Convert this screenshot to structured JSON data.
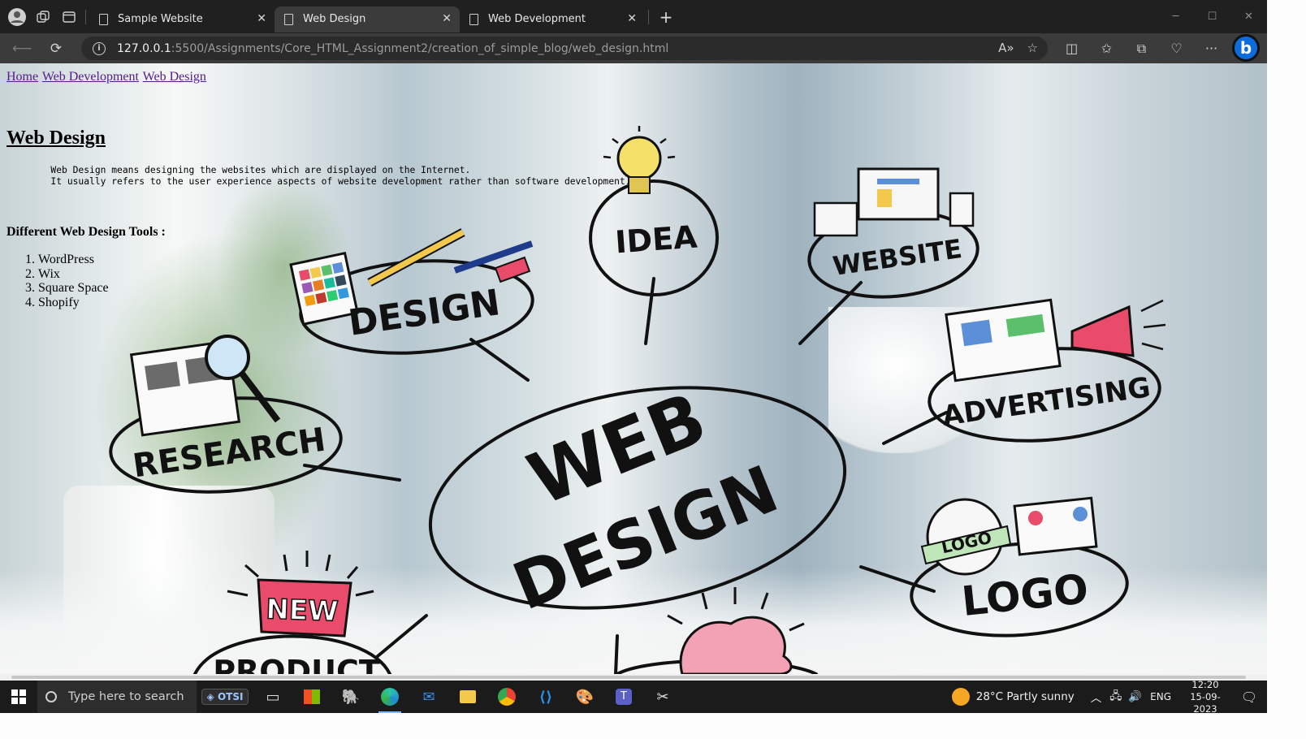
{
  "browser": {
    "tabs": [
      {
        "title": "Sample Website",
        "active": false
      },
      {
        "title": "Web Design",
        "active": true
      },
      {
        "title": "Web Development",
        "active": false
      }
    ],
    "address": {
      "host": "127.0.0.1",
      "rest": ":5500/Assignments/Core_HTML_Assignment2/creation_of_simple_blog/web_design.html"
    }
  },
  "page": {
    "nav": [
      "Home",
      "Web Development",
      "Web Design"
    ],
    "title": "Web Design",
    "description_line1": "Web Design means designing the websites which are displayed on the Internet.",
    "description_line2": "It usually refers to the user experience aspects of website development rather than software development.",
    "tools_heading": "Different Web Design Tools :",
    "tools": [
      "WordPress",
      "Wix",
      "Square Space",
      "Shopify"
    ]
  },
  "illustration": {
    "labels": {
      "idea": "IDEA",
      "website": "WEBSITE",
      "design": "DESIGN",
      "research": "RESEARCH",
      "advertising": "ADVERTISING",
      "center_line1": "WEB",
      "center_line2": "DESIGN",
      "logo": "LOGO",
      "logo_badge": "LOGO",
      "new": "NEW",
      "product": "PRODUCT"
    }
  },
  "taskbar": {
    "search_placeholder": "Type here to search",
    "weather": "28°C  Partly sunny",
    "language": "ENG",
    "time": "12:20",
    "date": "15-09-2023"
  }
}
